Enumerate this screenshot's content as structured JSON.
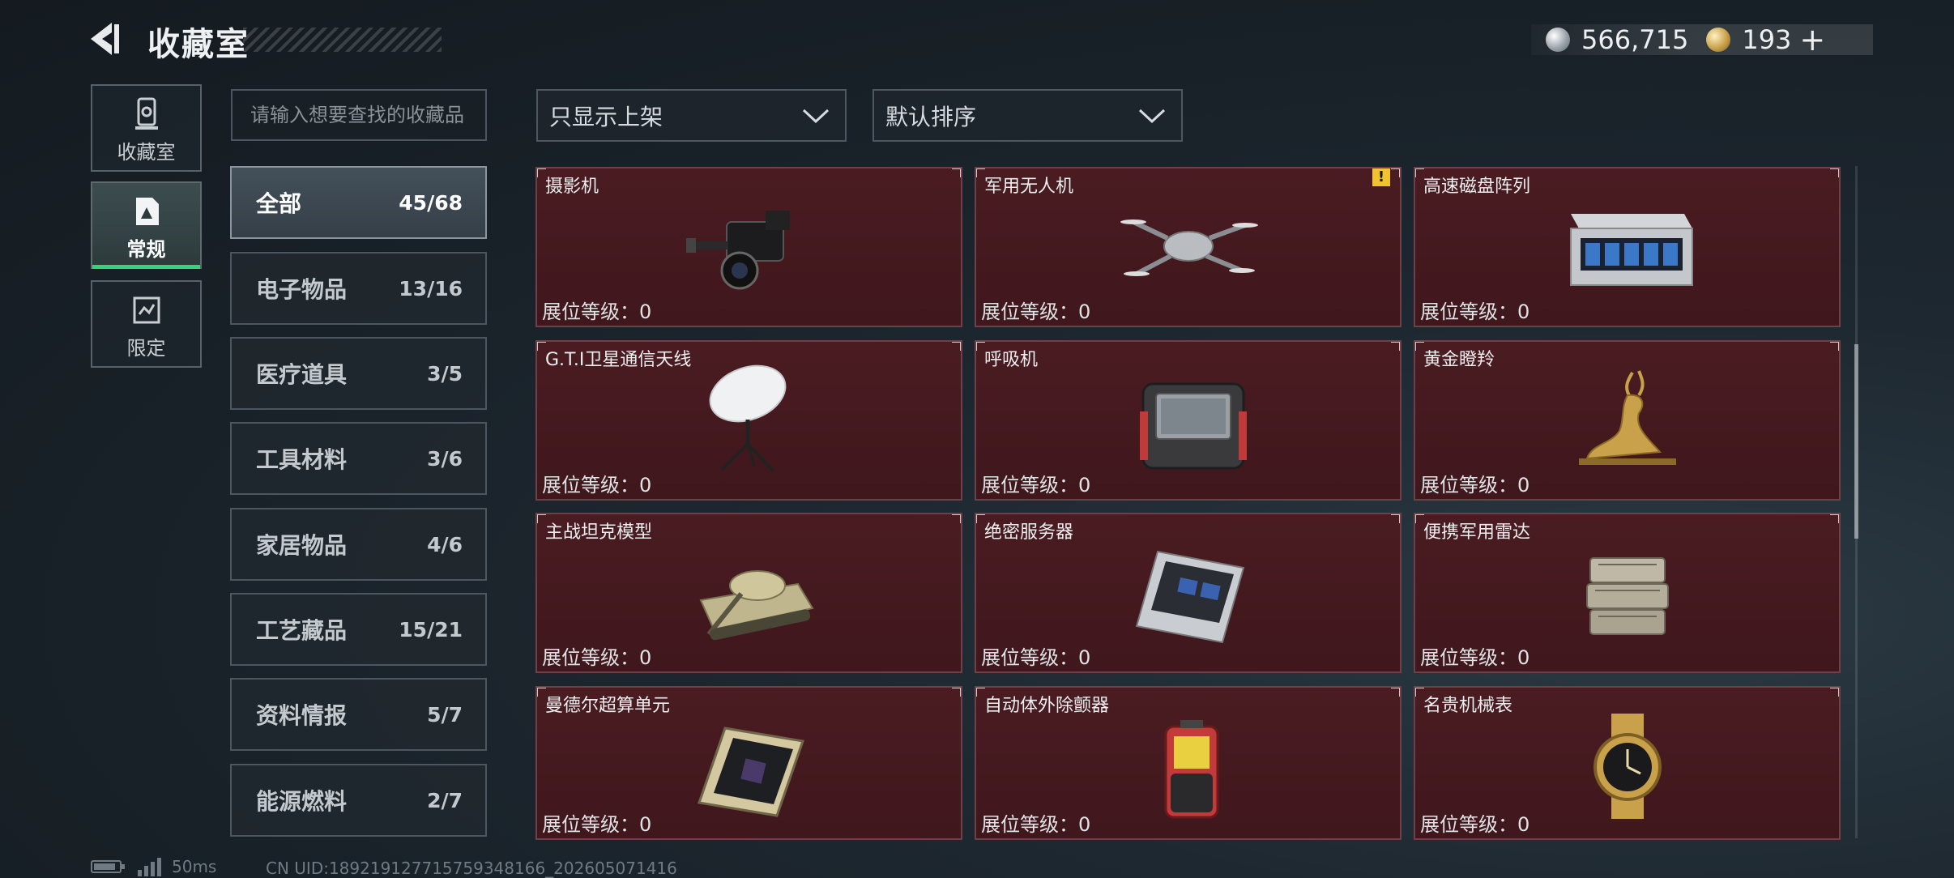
{
  "header": {
    "title": "收藏室",
    "currency": [
      {
        "icon": "silver-coin-icon",
        "value": "566,715"
      },
      {
        "icon": "gold-coin-icon",
        "value": "193"
      }
    ],
    "plus": "+"
  },
  "side_tabs": [
    {
      "label": "收藏室",
      "icon": "collection-room-icon"
    },
    {
      "label": "常规",
      "icon": "regular-icon",
      "active": true
    },
    {
      "label": "限定",
      "icon": "limited-icon"
    }
  ],
  "search": {
    "placeholder": "请输入想要查找的收藏品"
  },
  "categories": [
    {
      "name": "全部",
      "count": "45/68",
      "active": true
    },
    {
      "name": "电子物品",
      "count": "13/16"
    },
    {
      "name": "医疗道具",
      "count": "3/5"
    },
    {
      "name": "工具材料",
      "count": "3/6"
    },
    {
      "name": "家居物品",
      "count": "4/6"
    },
    {
      "name": "工艺藏品",
      "count": "15/21"
    },
    {
      "name": "资料情报",
      "count": "5/7"
    },
    {
      "name": "能源燃料",
      "count": "2/7"
    }
  ],
  "filters": {
    "show_filter": "只显示上架",
    "sort": "默认排序"
  },
  "items": [
    {
      "name": "摄影机",
      "level": "展位等级：0",
      "icon": "video-camera-icon"
    },
    {
      "name": "军用无人机",
      "level": "展位等级：0",
      "icon": "drone-icon",
      "warning": "!"
    },
    {
      "name": "高速磁盘阵列",
      "level": "展位等级：0",
      "icon": "disk-array-icon"
    },
    {
      "name": "G.T.I卫星通信天线",
      "level": "展位等级：0",
      "icon": "satellite-antenna-icon"
    },
    {
      "name": "呼吸机",
      "level": "展位等级：0",
      "icon": "ventilator-icon"
    },
    {
      "name": "黄金瞪羚",
      "level": "展位等级：0",
      "icon": "golden-gazelle-icon"
    },
    {
      "name": "主战坦克模型",
      "level": "展位等级：0",
      "icon": "tank-model-icon"
    },
    {
      "name": "绝密服务器",
      "level": "展位等级：0",
      "icon": "server-icon"
    },
    {
      "name": "便携军用雷达",
      "level": "展位等级：0",
      "icon": "radar-icon"
    },
    {
      "name": "曼德尔超算单元",
      "level": "展位等级：0",
      "icon": "supercompute-unit-icon"
    },
    {
      "name": "自动体外除颤器",
      "level": "展位等级：0",
      "icon": "defibrillator-icon"
    },
    {
      "name": "名贵机械表",
      "level": "展位等级：0",
      "icon": "watch-icon"
    }
  ],
  "footer": {
    "ping": "50ms",
    "uid": "CN UID:189219127715759348166_202605071416"
  }
}
